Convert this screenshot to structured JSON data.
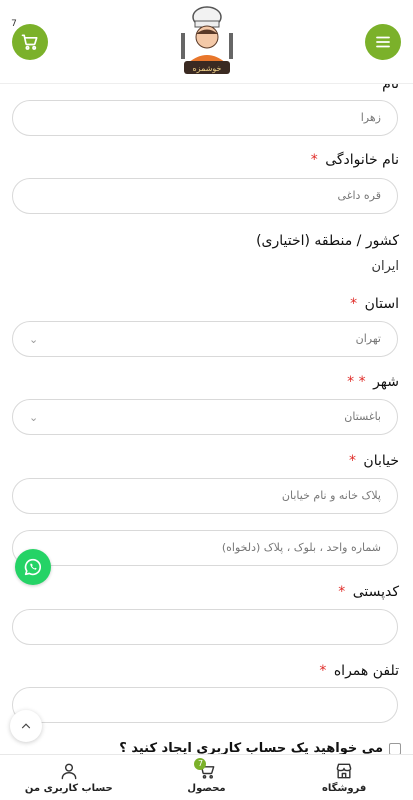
{
  "header": {
    "cart_count": "7",
    "logo_text": "خوشمزه"
  },
  "form": {
    "first_name": {
      "label": "نام",
      "value": "زهرا"
    },
    "last_name": {
      "label": "نام خانوادگی",
      "required": "*",
      "value": "قره داغی"
    },
    "country": {
      "label": "کشور / منطقه (اختیاری)",
      "value": "ایران"
    },
    "state": {
      "label": "استان",
      "required": "*",
      "value": "تهران"
    },
    "city": {
      "label": "شهر",
      "required": "* *",
      "value": "باغستان"
    },
    "street": {
      "label": "خیابان",
      "required": "*",
      "placeholder1": "پلاک خانه و نام خیابان",
      "placeholder2": "شماره واحد ، بلوک ، پلاک (دلخواه)"
    },
    "postcode": {
      "label": "کدپستی",
      "required": "*",
      "value": ""
    },
    "phone": {
      "label": "تلفن همراه",
      "required": "*",
      "value": ""
    },
    "create_account": {
      "label": "می خواهید یک حساب کاربری ایجاد کنید ؟"
    }
  },
  "bottom_nav": {
    "items": [
      {
        "label": "فروشگاه",
        "icon": "store-icon"
      },
      {
        "label": "محصول",
        "icon": "cart-icon",
        "badge": "7"
      },
      {
        "label": "حساب کاربری من",
        "icon": "user-icon"
      }
    ]
  },
  "colors": {
    "accent": "#7bb12a",
    "required": "#e02b27",
    "whatsapp": "#25d366"
  }
}
